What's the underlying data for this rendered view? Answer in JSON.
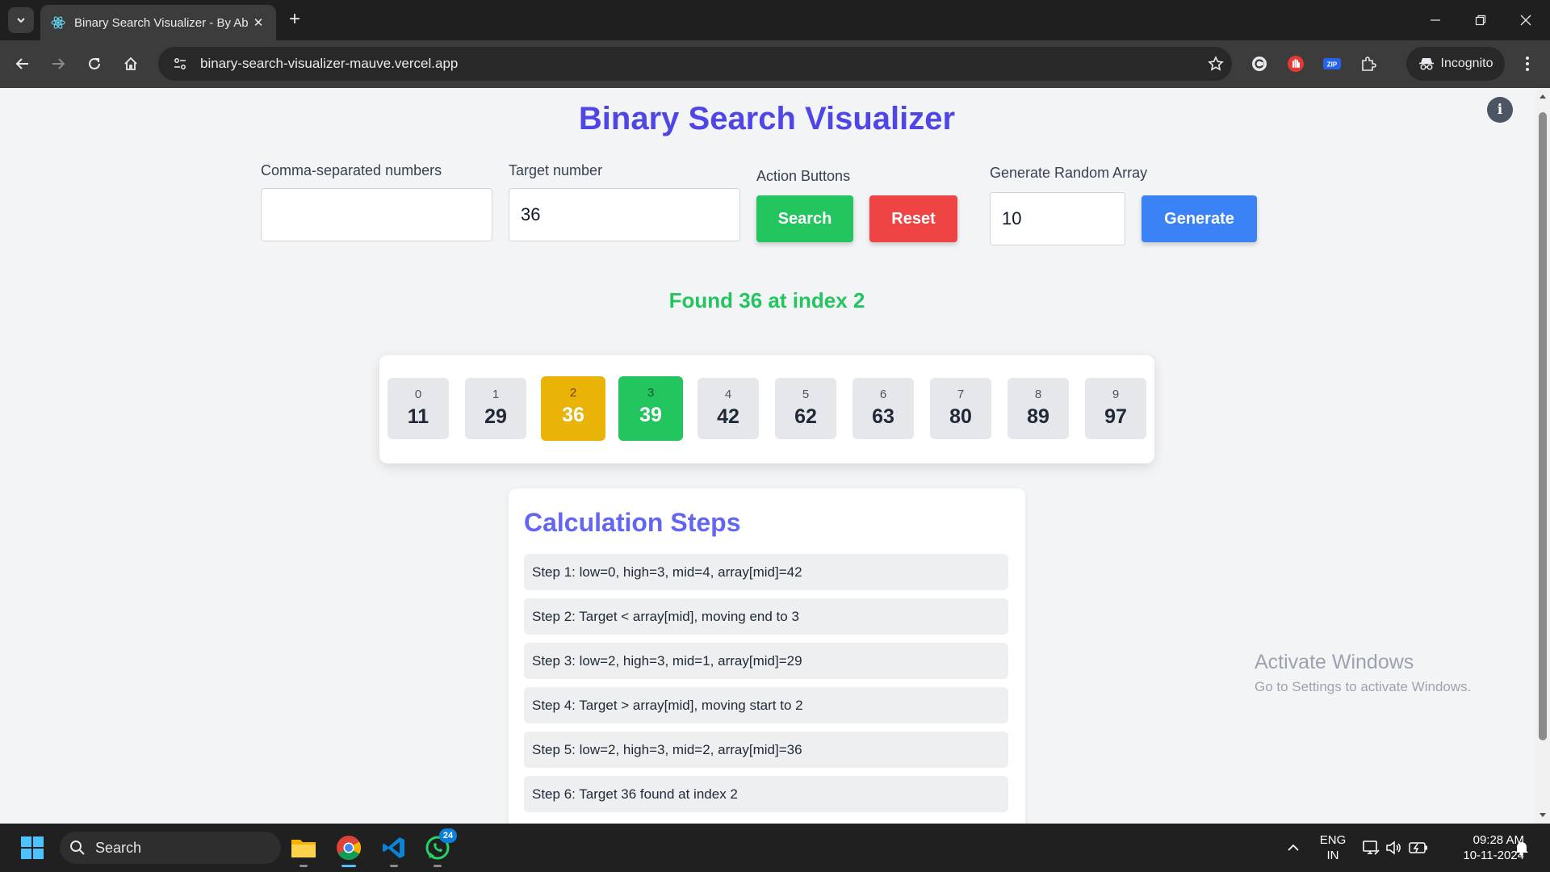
{
  "browser": {
    "tab_title": "Binary Search Visualizer - By Ab",
    "url": "binary-search-visualizer-mauve.vercel.app",
    "incognito_label": "Incognito"
  },
  "app": {
    "title": "Binary Search Visualizer",
    "numbers_label": "Comma-separated numbers",
    "numbers_value": "",
    "target_label": "Target number",
    "target_value": "36",
    "actions_label": "Action Buttons",
    "search_label": "Search",
    "reset_label": "Reset",
    "generate_label_heading": "Generate Random Array",
    "generate_count": "10",
    "generate_label": "Generate",
    "result": "Found 36 at index 2",
    "colors": {
      "title": "#4f46e5",
      "search": "#22c55e",
      "reset": "#ef4444",
      "generate": "#3b82f6",
      "mid_cell": "#eab308",
      "found_cell": "#22c55e"
    },
    "array": [
      {
        "index": "0",
        "value": "11",
        "state": "default"
      },
      {
        "index": "1",
        "value": "29",
        "state": "default"
      },
      {
        "index": "2",
        "value": "36",
        "state": "mid"
      },
      {
        "index": "3",
        "value": "39",
        "state": "found"
      },
      {
        "index": "4",
        "value": "42",
        "state": "default"
      },
      {
        "index": "5",
        "value": "62",
        "state": "default"
      },
      {
        "index": "6",
        "value": "63",
        "state": "default"
      },
      {
        "index": "7",
        "value": "80",
        "state": "default"
      },
      {
        "index": "8",
        "value": "89",
        "state": "default"
      },
      {
        "index": "9",
        "value": "97",
        "state": "default"
      }
    ],
    "steps_title": "Calculation Steps",
    "steps": [
      "Step 1: low=0, high=3, mid=4, array[mid]=42",
      "Step 2: Target < array[mid], moving end to 3",
      "Step 3: low=2, high=3, mid=1, array[mid]=29",
      "Step 4: Target > array[mid], moving start to 2",
      "Step 5: low=2, high=3, mid=2, array[mid]=36",
      "Step 6: Target 36 found at index 2"
    ]
  },
  "watermark": {
    "line1": "Activate Windows",
    "line2": "Go to Settings to activate Windows."
  },
  "taskbar": {
    "search_label": "Search",
    "whatsapp_badge": "24",
    "lang_line1": "ENG",
    "lang_line2": "IN",
    "time": "09:28 AM",
    "date": "10-11-2024"
  }
}
